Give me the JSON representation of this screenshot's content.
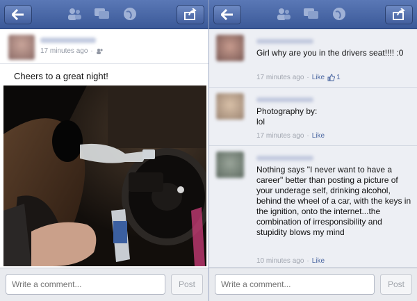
{
  "left": {
    "post": {
      "timestamp": "17 minutes ago",
      "text": "Cheers to a great night!"
    },
    "compose": {
      "placeholder": "Write a comment...",
      "post_label": "Post"
    }
  },
  "right": {
    "comments": [
      {
        "text": "Girl why are you in the drivers seat!!!! :0",
        "timestamp": "17 minutes ago",
        "like_label": "Like",
        "like_count": "1"
      },
      {
        "text": "Photography by: \nlol",
        "timestamp": "17 minutes ago",
        "like_label": "Like"
      },
      {
        "text": "Nothing says \"I never want to have a career\" better than posting a picture of your underage self, drinking alcohol, behind the wheel of a car, with the keys in the ignition, onto the internet...the combination of irresponsibility and stupidity blows my mind",
        "timestamp": "10 minutes ago",
        "like_label": "Like"
      }
    ],
    "compose": {
      "placeholder": "Write a comment...",
      "post_label": "Post"
    }
  },
  "colors": {
    "navbar": "#3b5998",
    "link": "#4b67a1",
    "meta": "#9197a3"
  }
}
